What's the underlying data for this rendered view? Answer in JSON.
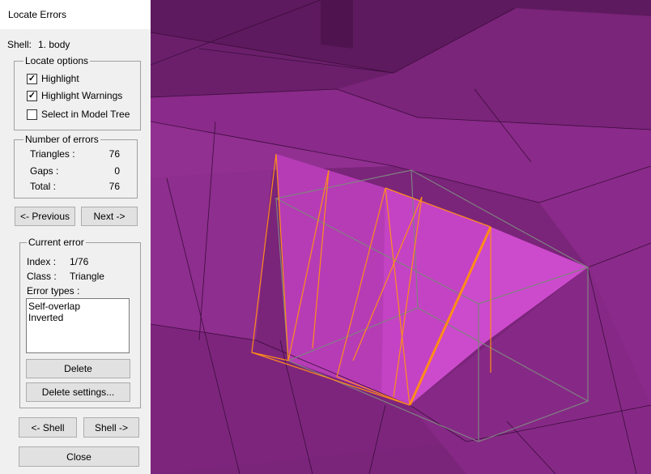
{
  "dialog": {
    "title": "Locate Errors",
    "shell_label": "Shell:",
    "shell_value": "1. body",
    "locate_options": {
      "legend": "Locate options",
      "highlight": {
        "label": "Highlight",
        "checked": true
      },
      "highlight_warnings": {
        "label": "Highlight Warnings",
        "checked": true
      },
      "select_in_model_tree": {
        "label": "Select in Model Tree",
        "checked": false
      }
    },
    "number_of_errors": {
      "legend": "Number of errors",
      "triangles_label": "Triangles :",
      "triangles_value": "76",
      "gaps_label": "Gaps :",
      "gaps_value": "0",
      "total_label": "Total :",
      "total_value": "76"
    },
    "previous_button": "<- Previous",
    "next_button": "Next ->",
    "current_error": {
      "legend": "Current error",
      "index_label": "Index :",
      "index_value": "1/76",
      "class_label": "Class :",
      "class_value": "Triangle",
      "error_types_label": "Error types :",
      "error_types": [
        "Self-overlap",
        "Inverted"
      ],
      "delete_button": "Delete",
      "delete_settings_button": "Delete settings..."
    },
    "prev_shell_button": "<- Shell",
    "next_shell_button": "Shell ->",
    "close_button": "Close"
  },
  "viewport": {
    "mesh_fill": "#7a247a",
    "face_fill": "#c443c4",
    "highlight_color": "#ff8c1a",
    "bbox_color": "#808080"
  }
}
